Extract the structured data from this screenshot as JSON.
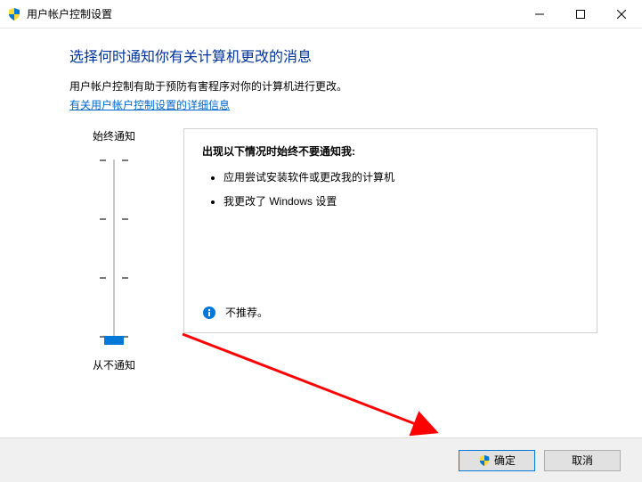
{
  "window": {
    "title": "用户帐户控制设置"
  },
  "header": {
    "heading": "选择何时通知你有关计算机更改的消息",
    "description": "用户帐户控制有助于预防有害程序对你的计算机进行更改。",
    "link": "有关用户帐户控制设置的详细信息"
  },
  "slider": {
    "top_label": "始终通知",
    "bottom_label": "从不通知"
  },
  "panel": {
    "heading": "出现以下情况时始终不要通知我:",
    "bullets": [
      "应用尝试安装软件或更改我的计算机",
      "我更改了 Windows 设置"
    ],
    "footer": "不推荐。"
  },
  "buttons": {
    "ok": "确定",
    "cancel": "取消"
  }
}
